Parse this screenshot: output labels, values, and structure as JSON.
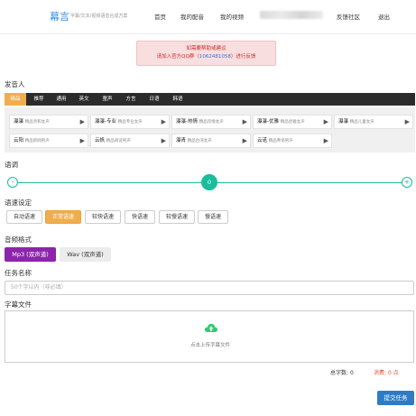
{
  "header": {
    "logo": "幕言",
    "subtitle": "字幕/文本/视频语音合成方案",
    "nav": [
      "首页",
      "我的配音",
      "我的视频",
      "反馈社区",
      "退出"
    ]
  },
  "notice": {
    "line1": "如需要帮助或建议",
    "line2_prefix": "请加入官方QQ群（",
    "qq": "1062481058",
    "line2_suffix": "）进行反馈"
  },
  "speaker": {
    "label": "发音人",
    "tabs": [
      "精品",
      "推荐",
      "通用",
      "英文",
      "童声",
      "方言",
      "日语",
      "韩语"
    ],
    "active_tab": "精品",
    "items": [
      {
        "name": "瀑瀑",
        "desc": "精品亲和女声"
      },
      {
        "name": "瀑瀑-专业",
        "desc": "精品专业女声"
      },
      {
        "name": "瀑瀑-热情",
        "desc": "精品热情女声"
      },
      {
        "name": "瀑瀑-优雅",
        "desc": "精品优雅女声"
      },
      {
        "name": "瀑瀑",
        "desc": "精品儿童女声"
      },
      {
        "name": "云阳",
        "desc": "精品新闻男声"
      },
      {
        "name": "云帆",
        "desc": "精品阅读男声"
      },
      {
        "name": "瀑青",
        "desc": "精品台湾女声"
      },
      {
        "name": "云诺",
        "desc": "精品粤语男声"
      }
    ]
  },
  "pitch": {
    "label": "语调",
    "value": "0",
    "minus": "-",
    "plus": "+"
  },
  "speed": {
    "label": "语速设定",
    "options": [
      "自动语速",
      "正常语速",
      "较快语速",
      "快语速",
      "较慢语速",
      "慢语速"
    ],
    "active": "正常语速"
  },
  "format": {
    "label": "音频格式",
    "options": [
      "Mp3 (双声道)",
      "Wav (双声道)"
    ],
    "active": "Mp3 (双声道)"
  },
  "task": {
    "label": "任务名称",
    "placeholder": "50个字以内（非必填）"
  },
  "subtitle_file": {
    "label": "字幕文件",
    "upload_text": "点击上传字幕文件"
  },
  "stats": {
    "count_label": "总字数:",
    "count_value": "0",
    "cost_label": "消费:",
    "cost_value": "0 点"
  },
  "submit_label": "提交任务",
  "colors": {
    "accent_orange": "#f0ad4e",
    "teal": "#1abc9c",
    "purple": "#8e24aa",
    "submit_blue": "#2f7bc3",
    "tabbar_dark": "#2b2b2b"
  }
}
